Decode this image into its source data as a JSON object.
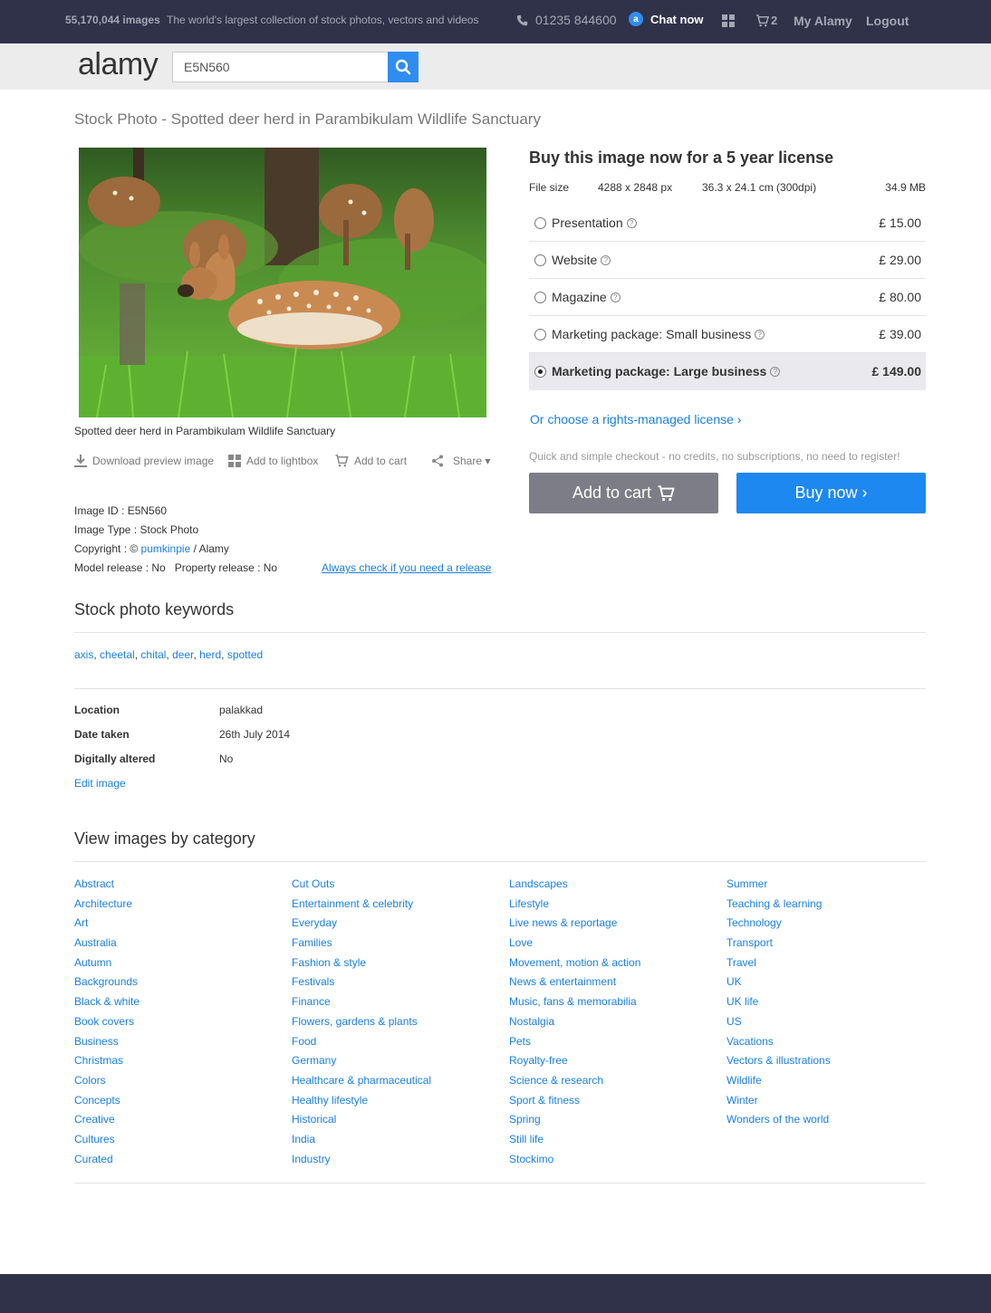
{
  "header": {
    "image_count": "55,170,044 images",
    "tagline": "The world's largest collection of stock photos, vectors and videos",
    "phone": "01235 844600",
    "chat": "Chat now",
    "chat_badge": "a",
    "cart_count": "2",
    "my_alamy": "My Alamy",
    "logout": "Logout"
  },
  "search": {
    "logo": "alamy",
    "value": "E5N560"
  },
  "page": {
    "title": "Stock Photo - Spotted deer herd in Parambikulam Wildlife Sanctuary",
    "caption": "Spotted deer herd in Parambikulam Wildlife Sanctuary"
  },
  "actions": {
    "download": "Download preview image",
    "lightbox": "Add to lightbox",
    "cart": "Add to cart",
    "share": "Share ▾"
  },
  "meta": {
    "image_id": "Image ID : E5N560",
    "image_type": "Image Type : Stock Photo",
    "copyright_prefix": "Copyright : © ",
    "copyright_author": "pumkinpie",
    "copyright_suffix": " / Alamy",
    "release_info": "Model release : No   Property release : No",
    "release_link": "Always check if you need a release"
  },
  "buy": {
    "title": "Buy this image now for a 5 year license",
    "file_size_label": "File size",
    "pixels": "4288 x 2848 px",
    "print": "36.3 x 24.1 cm (300dpi)",
    "mb": "34.9 MB",
    "options": [
      {
        "label": "Presentation",
        "price": "£ 15.00"
      },
      {
        "label": "Website",
        "price": "£ 29.00"
      },
      {
        "label": "Magazine",
        "price": "£ 80.00"
      },
      {
        "label": "Marketing package: Small business",
        "price": "£ 39.00"
      },
      {
        "label": "Marketing package: Large business",
        "price": "£ 149.00"
      }
    ],
    "rm_link": "Or choose a rights-managed license ›",
    "quick": "Quick and simple checkout - no credits, no subscriptions, no need to register!",
    "add_to_cart": "Add to cart",
    "buy_now": "Buy now ›"
  },
  "keywords": {
    "title": "Stock photo keywords",
    "items": [
      "axis",
      "cheetal",
      "chital",
      "deer",
      "herd",
      "spotted"
    ]
  },
  "details": {
    "location_label": "Location",
    "location": "palakkad",
    "date_label": "Date taken",
    "date": "26th July 2014",
    "altered_label": "Digitally altered",
    "altered": "No",
    "edit": "Edit image"
  },
  "categories": {
    "title": "View images by category",
    "col1": [
      "Abstract",
      "Architecture",
      "Art",
      "Australia",
      "Autumn",
      "Backgrounds",
      "Black & white",
      "Book covers",
      "Business",
      "Christmas",
      "Colors",
      "Concepts",
      "Creative",
      "Cultures",
      "Curated"
    ],
    "col2": [
      "Cut Outs",
      "Entertainment & celebrity",
      "Everyday",
      "Families",
      "Fashion & style",
      "Festivals",
      "Finance",
      "Flowers, gardens & plants",
      "Food",
      "Germany",
      "Healthcare & pharmaceutical",
      "Healthy lifestyle",
      "Historical",
      "India",
      "Industry"
    ],
    "col3": [
      "Landscapes",
      "Lifestyle",
      "Live news & reportage",
      "Love",
      "Movement, motion & action",
      "News & entertainment",
      "Music, fans & memorabilia",
      "Nostalgia",
      "Pets",
      "Royalty-free",
      "Science & research",
      "Sport & fitness",
      "Spring",
      "Still life",
      "Stockimo"
    ],
    "col4": [
      "Summer",
      "Teaching & learning",
      "Technology",
      "Transport",
      "Travel",
      "UK",
      "UK life",
      "US",
      "Vacations",
      "Vectors & illustrations",
      "Wildlife",
      "Winter",
      "Wonders of the world"
    ]
  },
  "colors": {
    "topbar": "#30324a",
    "accent": "#1c88f0",
    "link": "#1a7fe0"
  }
}
